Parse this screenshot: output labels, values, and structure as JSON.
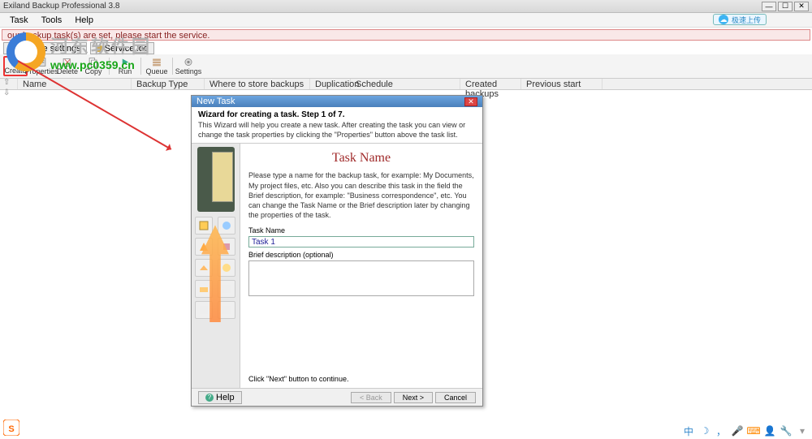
{
  "window": {
    "title": "Exiland Backup Professional 3.8",
    "controls": {
      "min": "—",
      "max": "☐",
      "close": "✕"
    }
  },
  "menu": [
    "Task",
    "Tools",
    "Help"
  ],
  "warning": "our backup task(s) are set, please start the service.",
  "service_buttons": {
    "settings": "Service settings",
    "log": "Service log"
  },
  "toolbar": [
    {
      "name": "create",
      "label": "Create"
    },
    {
      "name": "properties",
      "label": "Properties"
    },
    {
      "name": "delete",
      "label": "Delete"
    },
    {
      "name": "copy",
      "label": "Copy"
    },
    {
      "name": "run",
      "label": "Run"
    },
    {
      "name": "queue",
      "label": "Queue"
    },
    {
      "name": "settings",
      "label": "Settings"
    }
  ],
  "columns": {
    "name": "Name",
    "type": "Backup Type",
    "where": "Where to store backups",
    "dup": "Duplication",
    "sched": "Schedule",
    "created": "Created backups",
    "prev": "Previous start"
  },
  "watermark": {
    "cn": "河东软件园",
    "url": "www.pc0359.cn"
  },
  "cloud": {
    "text": "极速上传"
  },
  "dialog": {
    "title": "New Task",
    "header_title": "Wizard for creating a task. Step 1 of 7.",
    "header_desc": "This Wizard will help you create a new task. After creating the task you can view or change the task properties by clicking the \"Properties\" button above the task list.",
    "main_title": "Task Name",
    "instructions": "Please type a name for the backup task, for example: My Documents, My project files, etc. Also you can describe this task in the field the Brief description, for example: \"Business correspondence\", etc. You can change the Task Name or the Brief description later by changing the properties of the task.",
    "field_taskname_label": "Task Name",
    "field_taskname_value": "Task 1",
    "field_brief_label": "Brief description (optional)",
    "continue_text": "Click \"Next\" button to continue.",
    "help": "Help",
    "back": "< Back",
    "next": "Next >",
    "cancel": "Cancel"
  },
  "tray_icons": [
    "s-logo",
    "cn",
    "moon",
    "mic",
    "clock",
    "grid",
    "user",
    "vol",
    "wifi"
  ]
}
